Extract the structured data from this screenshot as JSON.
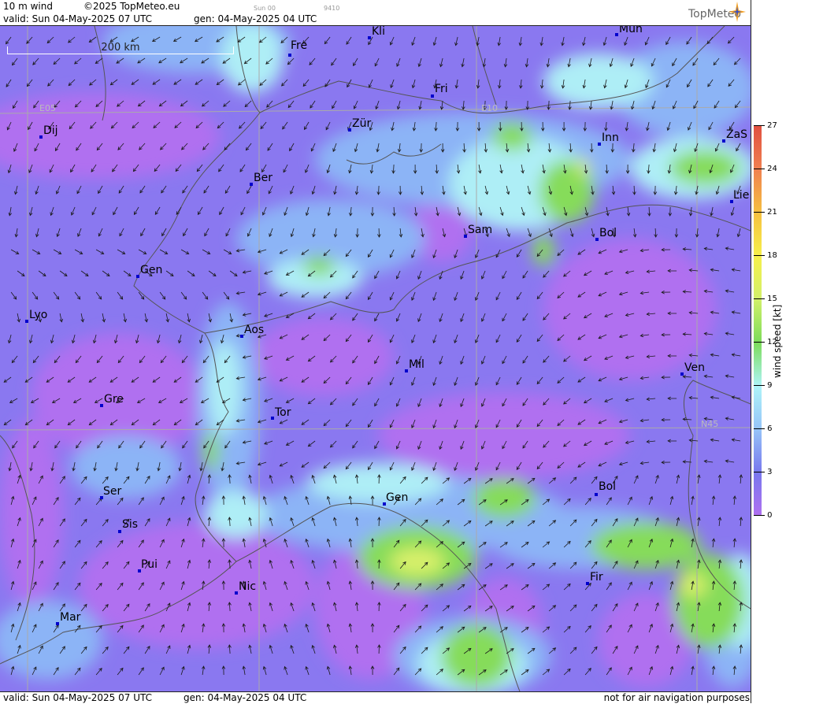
{
  "header": {
    "product": "10 m wind",
    "copyright": "©2025 TopMeteo.eu",
    "valid": "valid:  Sun  04-May-2025  07 UTC",
    "gen": "gen: 04-May-2025 04 UTC",
    "run_small": "Sun 00",
    "code_small": "9410",
    "logo": "TopMeteo"
  },
  "footer": {
    "valid": "valid:  Sun  04-May-2025  07 UTC",
    "gen": "gen: 04-May-2025 04 UTC",
    "disclaimer": "not for air navigation purposes"
  },
  "scale": {
    "label": "200 km"
  },
  "grid_labels": [
    "E05",
    "E10",
    "N45"
  ],
  "cities": [
    {
      "name": "Kli"
    },
    {
      "name": "Mun"
    },
    {
      "name": "Fre"
    },
    {
      "name": "Fri"
    },
    {
      "name": "Dij"
    },
    {
      "name": "Zür"
    },
    {
      "name": "Inn"
    },
    {
      "name": "ZaS"
    },
    {
      "name": "Ber"
    },
    {
      "name": "Lie"
    },
    {
      "name": "Sam"
    },
    {
      "name": "Bol"
    },
    {
      "name": "Gen"
    },
    {
      "name": "Lyo"
    },
    {
      "name": "Aos"
    },
    {
      "name": "Mil"
    },
    {
      "name": "Ven"
    },
    {
      "name": "Gre"
    },
    {
      "name": "Tor"
    },
    {
      "name": "Ser"
    },
    {
      "name": "Gen"
    },
    {
      "name": "Bol"
    },
    {
      "name": "Sis"
    },
    {
      "name": "Pui"
    },
    {
      "name": "Fir"
    },
    {
      "name": "Nic"
    },
    {
      "name": "Mar"
    }
  ],
  "legend": {
    "title": "wind speed [kt]",
    "ticks": [
      "27",
      "24",
      "21",
      "18",
      "15",
      "12",
      "9",
      "6",
      "3",
      "0"
    ],
    "colors": [
      "#e05040",
      "#f08050",
      "#f6c040",
      "#f6f04a",
      "#d2f06a",
      "#7cdc5a",
      "#aef4f8",
      "#96c4f8",
      "#7878ee",
      "#b070f0"
    ]
  },
  "palette": {
    "calm": "#b070f0",
    "light": "#8a78f0",
    "moderate": "#8cb4f6",
    "fresh": "#aeeef6",
    "strong": "#86dc5a",
    "gale": "#d8f06a"
  }
}
